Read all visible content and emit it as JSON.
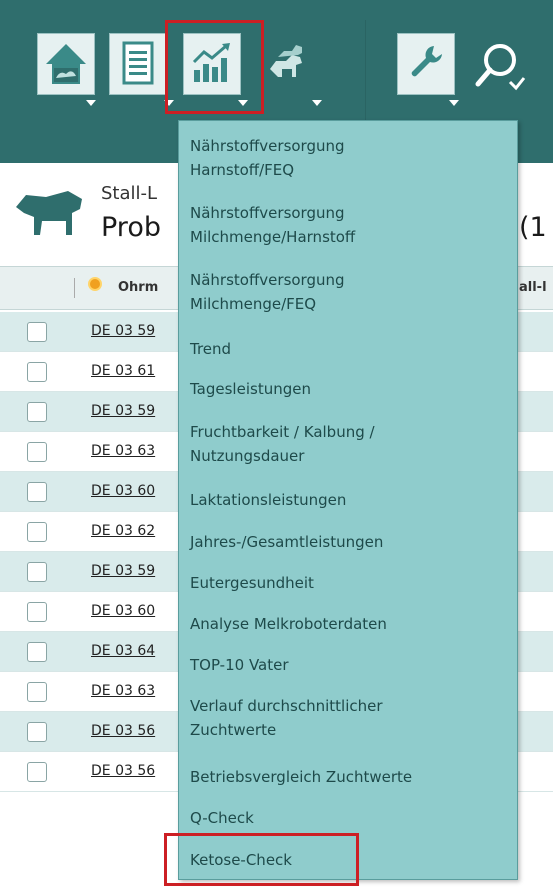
{
  "toolbar": {
    "buttons": [
      {
        "name": "home-icon"
      },
      {
        "name": "document-icon"
      },
      {
        "name": "chart-icon"
      },
      {
        "name": "cows-icon"
      },
      {
        "name": "tools-icon"
      },
      {
        "name": "search-icon"
      }
    ]
  },
  "header": {
    "stall_label": "Stall-L",
    "probe_label": "Prob",
    "count_label": "(1"
  },
  "columns": {
    "ohrm": "Ohrm",
    "stall": "all-l"
  },
  "rows": [
    "DE 03 59",
    "DE 03 61",
    "DE 03 59",
    "DE 03 63",
    "DE 03 60",
    "DE 03 62",
    "DE 03 59",
    "DE 03 60",
    "DE 03 64",
    "DE 03 63",
    "DE 03 56",
    "DE 03 56"
  ],
  "menu": {
    "items": [
      "Nährstoffversorgung",
      "Harnstoff/FEQ",
      "Nährstoffversorgung",
      "Milchmenge/Harnstoff",
      "Nährstoffversorgung",
      "Milchmenge/FEQ",
      "Trend",
      "Tagesleistungen",
      "Fruchtbarkeit / Kalbung /",
      "Nutzungsdauer",
      "Laktationsleistungen",
      "Jahres-/Gesamtleistungen",
      "Eutergesundheit",
      "Analyse Melkroboterdaten",
      "TOP-10 Vater",
      "Verlauf durchschnittlicher",
      "Zuchtwerte",
      "Betriebsvergleich Zuchtwerte",
      "Q-Check",
      "Ketose-Check"
    ]
  },
  "colors": {
    "toolbar_bg": "#2f6e6d",
    "menu_bg": "#8fcccc",
    "highlight": "#cc1f24",
    "row_alt": "#d9ebeb"
  }
}
